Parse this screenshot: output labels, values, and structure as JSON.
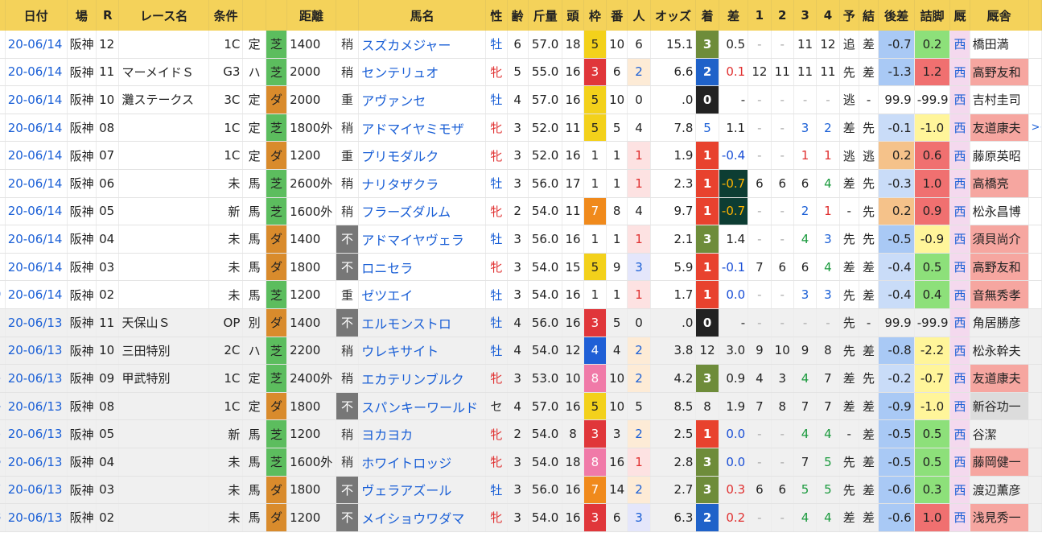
{
  "headers": [
    "",
    "日付",
    "場",
    "R",
    "レース名",
    "条件",
    "",
    "",
    "距離",
    "",
    "馬名",
    "性",
    "齢",
    "斤量",
    "頭",
    "枠",
    "番",
    "人",
    "オッズ",
    "着",
    "差",
    "1",
    "2",
    "3",
    "4",
    "予",
    "結",
    "後差",
    "詰脚",
    "厩",
    "厩舎",
    ""
  ],
  "rows": [
    {
      "g": false,
      "n": "",
      "date": "20-06/14",
      "venue": "阪神",
      "r": "12",
      "race": "",
      "cls": "1C",
      "kind": "定",
      "surf": "芝",
      "dist": "1400",
      "cond": "稍",
      "horse": "スズカメジャー",
      "sex": "牡",
      "age": "6",
      "wt": "57.0",
      "heads": "18",
      "waku": "5",
      "ban": "10",
      "pop": "6",
      "odds": "15.1",
      "place": "3",
      "diff": "0.5",
      "c1": "-",
      "c2": "-",
      "c3": "11",
      "c4": "12",
      "pred": "追",
      "res": "差",
      "back": "-0.7",
      "fin": "0.2",
      "st": "西",
      "trainer": "橋田満",
      "tail": ""
    },
    {
      "g": false,
      "n": "",
      "date": "20-06/14",
      "venue": "阪神",
      "r": "11",
      "race": "マーメイドＳ",
      "cls": "G3",
      "kind": "ハ",
      "surf": "芝",
      "dist": "2000",
      "cond": "稍",
      "horse": "センテリュオ",
      "sex": "牝",
      "age": "5",
      "wt": "55.0",
      "heads": "16",
      "waku": "3",
      "ban": "6",
      "pop": "2",
      "odds": "6.6",
      "place": "2",
      "diff": "0.1",
      "c1": "12",
      "c2": "11",
      "c3": "11",
      "c4": "11",
      "pred": "先",
      "res": "差",
      "back": "-1.3",
      "fin": "1.2",
      "st": "西",
      "trainer": "高野友和",
      "tail": ""
    },
    {
      "g": false,
      "n": "",
      "date": "20-06/14",
      "venue": "阪神",
      "r": "10",
      "race": "灘ステークス",
      "cls": "3C",
      "kind": "定",
      "surf": "ダ",
      "dist": "2000",
      "cond": "重",
      "horse": "アヴァンセ",
      "sex": "牡",
      "age": "4",
      "wt": "57.0",
      "heads": "16",
      "waku": "5",
      "ban": "10",
      "pop": "0",
      "odds": ".0",
      "place": "0",
      "diff": "-",
      "c1": "-",
      "c2": "-",
      "c3": "-",
      "c4": "-",
      "pred": "逃",
      "res": "-",
      "back": "99.9",
      "fin": "-99.9",
      "st": "西",
      "trainer": "吉村圭司",
      "tail": ""
    },
    {
      "g": false,
      "n": "",
      "date": "20-06/14",
      "venue": "阪神",
      "r": "08",
      "race": "",
      "cls": "1C",
      "kind": "定",
      "surf": "芝",
      "dist": "1800外",
      "cond": "稍",
      "horse": "アドマイヤミモザ",
      "sex": "牝",
      "age": "3",
      "wt": "52.0",
      "heads": "11",
      "waku": "5",
      "ban": "5",
      "pop": "4",
      "odds": "7.8",
      "place": "5",
      "diff": "1.1",
      "c1": "-",
      "c2": "-",
      "c3": "3",
      "c4": "2",
      "pred": "差",
      "res": "先",
      "back": "-0.1",
      "fin": "-1.0",
      "st": "西",
      "trainer": "友道康夫",
      "tail": "><"
    },
    {
      "g": false,
      "n": "",
      "date": "20-06/14",
      "venue": "阪神",
      "r": "07",
      "race": "",
      "cls": "1C",
      "kind": "定",
      "surf": "ダ",
      "dist": "1200",
      "cond": "重",
      "horse": "プリモダルク",
      "sex": "牝",
      "age": "3",
      "wt": "52.0",
      "heads": "16",
      "waku": "1",
      "ban": "1",
      "pop": "1",
      "odds": "1.9",
      "place": "1",
      "diff": "-0.4",
      "c1": "-",
      "c2": "-",
      "c3": "1",
      "c4": "1",
      "pred": "逃",
      "res": "逃",
      "back": "0.2",
      "fin": "0.6",
      "st": "西",
      "trainer": "藤原英昭",
      "tail": ""
    },
    {
      "g": false,
      "n": "",
      "date": "20-06/14",
      "venue": "阪神",
      "r": "06",
      "race": "",
      "cls": "未",
      "kind": "馬",
      "surf": "芝",
      "dist": "2600外",
      "cond": "稍",
      "horse": "ナリタザクラ",
      "sex": "牡",
      "age": "3",
      "wt": "56.0",
      "heads": "17",
      "waku": "1",
      "ban": "1",
      "pop": "1",
      "odds": "2.3",
      "place": "1",
      "diff": "-0.7",
      "c1": "6",
      "c2": "6",
      "c3": "6",
      "c4": "4",
      "pred": "差",
      "res": "先",
      "back": "-0.3",
      "fin": "1.0",
      "st": "西",
      "trainer": "高橋亮",
      "tail": ""
    },
    {
      "g": false,
      "n": "",
      "date": "20-06/14",
      "venue": "阪神",
      "r": "05",
      "race": "",
      "cls": "新",
      "kind": "馬",
      "surf": "芝",
      "dist": "1600外",
      "cond": "稍",
      "horse": "フラーズダルム",
      "sex": "牝",
      "age": "2",
      "wt": "54.0",
      "heads": "11",
      "waku": "7",
      "ban": "8",
      "pop": "4",
      "odds": "9.7",
      "place": "1",
      "diff": "-0.7",
      "c1": "-",
      "c2": "-",
      "c3": "2",
      "c4": "1",
      "pred": "-",
      "res": "先",
      "back": "0.2",
      "fin": "0.9",
      "st": "西",
      "trainer": "松永昌博",
      "tail": ""
    },
    {
      "g": false,
      "n": "",
      "date": "20-06/14",
      "venue": "阪神",
      "r": "04",
      "race": "",
      "cls": "未",
      "kind": "馬",
      "surf": "ダ",
      "dist": "1400",
      "cond": "不",
      "horse": "アドマイヤヴェラ",
      "sex": "牡",
      "age": "3",
      "wt": "56.0",
      "heads": "16",
      "waku": "1",
      "ban": "1",
      "pop": "1",
      "odds": "2.1",
      "place": "3",
      "diff": "1.4",
      "c1": "-",
      "c2": "-",
      "c3": "4",
      "c4": "3",
      "pred": "先",
      "res": "先",
      "back": "-0.5",
      "fin": "-0.9",
      "st": "西",
      "trainer": "須貝尚介",
      "tail": ""
    },
    {
      "g": false,
      "n": "",
      "date": "20-06/14",
      "venue": "阪神",
      "r": "03",
      "race": "",
      "cls": "未",
      "kind": "馬",
      "surf": "ダ",
      "dist": "1800",
      "cond": "不",
      "horse": "ロニセラ",
      "sex": "牝",
      "age": "3",
      "wt": "54.0",
      "heads": "15",
      "waku": "5",
      "ban": "9",
      "pop": "3",
      "odds": "5.9",
      "place": "1",
      "diff": "-0.1",
      "c1": "7",
      "c2": "6",
      "c3": "6",
      "c4": "4",
      "pred": "差",
      "res": "差",
      "back": "-0.4",
      "fin": "0.5",
      "st": "西",
      "trainer": "高野友和",
      "tail": ""
    },
    {
      "g": false,
      "n": "0",
      "date": "20-06/14",
      "venue": "阪神",
      "r": "02",
      "race": "",
      "cls": "未",
      "kind": "馬",
      "surf": "芝",
      "dist": "1200",
      "cond": "重",
      "horse": "ゼツエイ",
      "sex": "牡",
      "age": "3",
      "wt": "54.0",
      "heads": "16",
      "waku": "1",
      "ban": "1",
      "pop": "1",
      "odds": "1.7",
      "place": "1",
      "diff": "0.0",
      "c1": "-",
      "c2": "-",
      "c3": "3",
      "c4": "3",
      "pred": "先",
      "res": "差",
      "back": "-0.4",
      "fin": "0.4",
      "st": "西",
      "trainer": "音無秀孝",
      "tail": ""
    },
    {
      "g": true,
      "n": "",
      "date": "20-06/13",
      "venue": "阪神",
      "r": "11",
      "race": "天保山Ｓ",
      "cls": "OP",
      "kind": "別",
      "surf": "ダ",
      "dist": "1400",
      "cond": "不",
      "horse": "エルモンストロ",
      "sex": "牡",
      "age": "4",
      "wt": "56.0",
      "heads": "16",
      "waku": "3",
      "ban": "5",
      "pop": "0",
      "odds": ".0",
      "place": "0",
      "diff": "-",
      "c1": "-",
      "c2": "-",
      "c3": "-",
      "c4": "-",
      "pred": "先",
      "res": "-",
      "back": "99.9",
      "fin": "-99.9",
      "st": "西",
      "trainer": "角居勝彦",
      "tail": ""
    },
    {
      "g": true,
      "n": "2",
      "date": "20-06/13",
      "venue": "阪神",
      "r": "10",
      "race": "三田特別",
      "cls": "2C",
      "kind": "ハ",
      "surf": "芝",
      "dist": "2200",
      "cond": "稍",
      "horse": "ウレキサイト",
      "sex": "牡",
      "age": "4",
      "wt": "54.0",
      "heads": "12",
      "waku": "4",
      "ban": "4",
      "pop": "2",
      "odds": "3.8",
      "place": "12",
      "diff": "3.0",
      "c1": "9",
      "c2": "10",
      "c3": "9",
      "c4": "8",
      "pred": "先",
      "res": "差",
      "back": "-0.8",
      "fin": "-2.2",
      "st": "西",
      "trainer": "松永幹夫",
      "tail": ""
    },
    {
      "g": true,
      "n": "3",
      "date": "20-06/13",
      "venue": "阪神",
      "r": "09",
      "race": "甲武特別",
      "cls": "1C",
      "kind": "定",
      "surf": "芝",
      "dist": "2400外",
      "cond": "稍",
      "horse": "エカテリンブルク",
      "sex": "牝",
      "age": "3",
      "wt": "53.0",
      "heads": "10",
      "waku": "8",
      "ban": "10",
      "pop": "2",
      "odds": "4.2",
      "place": "3",
      "diff": "0.9",
      "c1": "4",
      "c2": "3",
      "c3": "4",
      "c4": "7",
      "pred": "差",
      "res": "先",
      "back": "-0.2",
      "fin": "-0.7",
      "st": "西",
      "trainer": "友道康夫",
      "tail": ""
    },
    {
      "g": true,
      "n": "4",
      "date": "20-06/13",
      "venue": "阪神",
      "r": "08",
      "race": "",
      "cls": "1C",
      "kind": "定",
      "surf": "ダ",
      "dist": "1800",
      "cond": "不",
      "horse": "スパンキーワールド",
      "sex": "セ",
      "age": "4",
      "wt": "57.0",
      "heads": "16",
      "waku": "5",
      "ban": "10",
      "pop": "5",
      "odds": "8.5",
      "place": "8",
      "diff": "1.9",
      "c1": "7",
      "c2": "8",
      "c3": "7",
      "c4": "7",
      "pred": "差",
      "res": "差",
      "back": "-0.9",
      "fin": "-1.0",
      "st": "西",
      "trainer": "新谷功一",
      "tail": ""
    },
    {
      "g": true,
      "n": "5",
      "date": "20-06/13",
      "venue": "阪神",
      "r": "05",
      "race": "",
      "cls": "新",
      "kind": "馬",
      "surf": "芝",
      "dist": "1200",
      "cond": "稍",
      "horse": "ヨカヨカ",
      "sex": "牝",
      "age": "2",
      "wt": "54.0",
      "heads": "8",
      "waku": "3",
      "ban": "3",
      "pop": "2",
      "odds": "2.5",
      "place": "1",
      "diff": "0.0",
      "c1": "-",
      "c2": "-",
      "c3": "4",
      "c4": "4",
      "pred": "-",
      "res": "差",
      "back": "-0.5",
      "fin": "0.5",
      "st": "西",
      "trainer": "谷潔",
      "tail": ""
    },
    {
      "g": true,
      "n": "6",
      "date": "20-06/13",
      "venue": "阪神",
      "r": "04",
      "race": "",
      "cls": "未",
      "kind": "馬",
      "surf": "芝",
      "dist": "1600外",
      "cond": "稍",
      "horse": "ホワイトロッジ",
      "sex": "牝",
      "age": "3",
      "wt": "54.0",
      "heads": "18",
      "waku": "8",
      "ban": "16",
      "pop": "1",
      "odds": "2.8",
      "place": "3",
      "diff": "0.0",
      "c1": "-",
      "c2": "-",
      "c3": "7",
      "c4": "5",
      "pred": "先",
      "res": "差",
      "back": "-0.5",
      "fin": "0.5",
      "st": "西",
      "trainer": "藤岡健一",
      "tail": ""
    },
    {
      "g": true,
      "n": "7",
      "date": "20-06/13",
      "venue": "阪神",
      "r": "03",
      "race": "",
      "cls": "未",
      "kind": "馬",
      "surf": "ダ",
      "dist": "1800",
      "cond": "不",
      "horse": "ヴェラアズール",
      "sex": "牡",
      "age": "3",
      "wt": "56.0",
      "heads": "16",
      "waku": "7",
      "ban": "14",
      "pop": "2",
      "odds": "2.7",
      "place": "3",
      "diff": "0.3",
      "c1": "6",
      "c2": "6",
      "c3": "5",
      "c4": "5",
      "pred": "先",
      "res": "差",
      "back": "-0.6",
      "fin": "0.3",
      "st": "西",
      "trainer": "渡辺薫彦",
      "tail": ""
    },
    {
      "g": true,
      "n": "8",
      "date": "20-06/13",
      "venue": "阪神",
      "r": "02",
      "race": "",
      "cls": "未",
      "kind": "馬",
      "surf": "ダ",
      "dist": "1200",
      "cond": "不",
      "horse": "メイショウワダマ",
      "sex": "牝",
      "age": "3",
      "wt": "54.0",
      "heads": "16",
      "waku": "3",
      "ban": "6",
      "pop": "3",
      "odds": "6.3",
      "place": "2",
      "diff": "0.2",
      "c1": "-",
      "c2": "-",
      "c3": "4",
      "c4": "4",
      "pred": "差",
      "res": "差",
      "back": "-0.6",
      "fin": "1.0",
      "st": "西",
      "trainer": "浅見秀一",
      "tail": ""
    }
  ],
  "colors": {
    "header_bg": "#f4d25a",
    "turf": "#5cbd5e",
    "dirt": "#d98b2c",
    "waku": {
      "1": "#ffffff",
      "2": "#222222",
      "3": "#e0363a",
      "4": "#1f5fd6",
      "5": "#f3d11b",
      "6": "#3d9a3d",
      "7": "#f08a1c",
      "8": "#f07aa8"
    },
    "place1": "#e8422e",
    "place2": "#1f62c9",
    "place3": "#6e8c3a",
    "place0": "#222222",
    "back_good": "#a9c9f5",
    "fin_good": "#8de07a",
    "fin_great": "#f07070",
    "fin_bad": "#fff59a",
    "trainer_hl": "#f6a6a0"
  }
}
